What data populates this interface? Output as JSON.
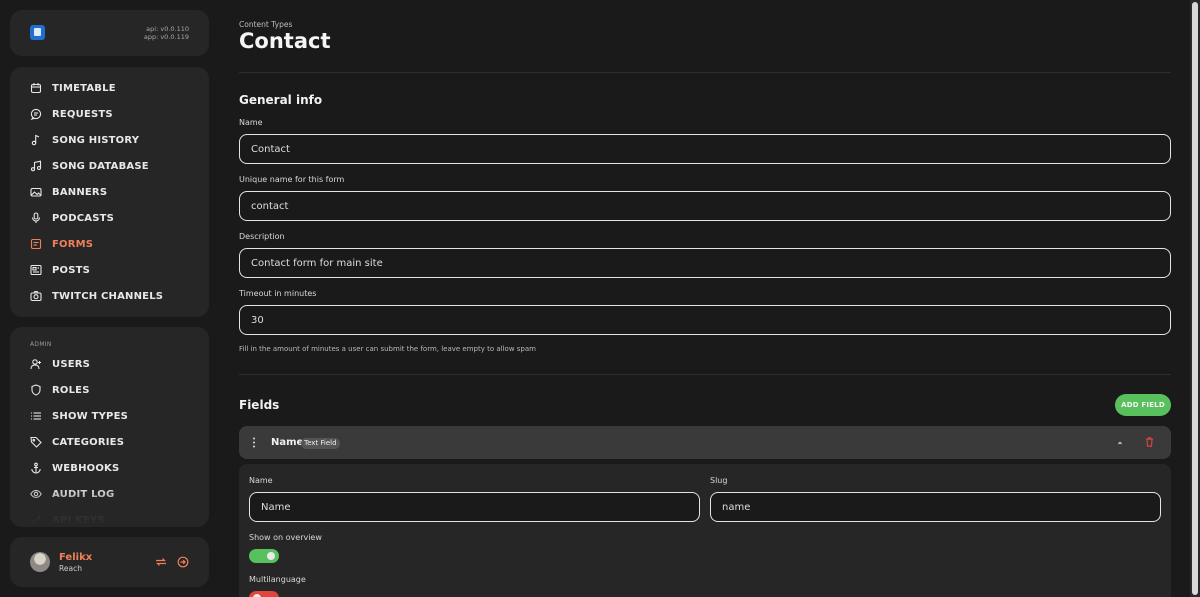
{
  "brand": {
    "api_version": "api: v0.0.110",
    "app_version": "app: v0.0.119"
  },
  "nav_main": [
    {
      "label": "TIMETABLE",
      "icon": "calendar-icon"
    },
    {
      "label": "REQUESTS",
      "icon": "chat-icon"
    },
    {
      "label": "SONG HISTORY",
      "icon": "music-note-icon"
    },
    {
      "label": "SONG DATABASE",
      "icon": "music-notes-icon"
    },
    {
      "label": "BANNERS",
      "icon": "image-icon"
    },
    {
      "label": "PODCASTS",
      "icon": "microphone-icon"
    },
    {
      "label": "FORMS",
      "icon": "form-icon",
      "active": true
    },
    {
      "label": "POSTS",
      "icon": "newspaper-icon"
    },
    {
      "label": "TWITCH CHANNELS",
      "icon": "camera-icon"
    }
  ],
  "nav_admin": {
    "section_label": "ADMIN",
    "items": [
      {
        "label": "USERS",
        "icon": "users-icon"
      },
      {
        "label": "ROLES",
        "icon": "shield-icon"
      },
      {
        "label": "SHOW TYPES",
        "icon": "list-icon"
      },
      {
        "label": "CATEGORIES",
        "icon": "tag-icon"
      },
      {
        "label": "WEBHOOKS",
        "icon": "anchor-icon"
      },
      {
        "label": "AUDIT LOG",
        "icon": "eye-icon"
      },
      {
        "label": "API KEYS",
        "icon": "key-icon"
      }
    ]
  },
  "user": {
    "name": "Felikx",
    "subtitle": "Reach"
  },
  "page": {
    "breadcrumb": "Content Types",
    "title": "Contact"
  },
  "general_info": {
    "heading": "General info",
    "name_label": "Name",
    "name_value": "Contact",
    "unique_label": "Unique name for this form",
    "unique_value": "contact",
    "description_label": "Description",
    "description_value": "Contact form for main site",
    "timeout_label": "Timeout in minutes",
    "timeout_value": "30",
    "timeout_hint": "Fill in the amount of minutes a user can submit the form, leave empty to allow spam"
  },
  "fields": {
    "heading": "Fields",
    "add_button": "ADD FIELD",
    "items": [
      {
        "title": "Name",
        "type_badge": "Text Field",
        "name_label": "Name",
        "name_value": "Name",
        "slug_label": "Slug",
        "slug_value": "name",
        "show_on_overview_label": "Show on overview",
        "show_on_overview": true,
        "multilanguage_label": "Multilanguage",
        "multilanguage": false
      }
    ]
  },
  "colors": {
    "accent": "#f0805a",
    "success": "#58c15e",
    "danger": "#e0463c",
    "background": "#1a1a1a",
    "card": "#262626"
  }
}
